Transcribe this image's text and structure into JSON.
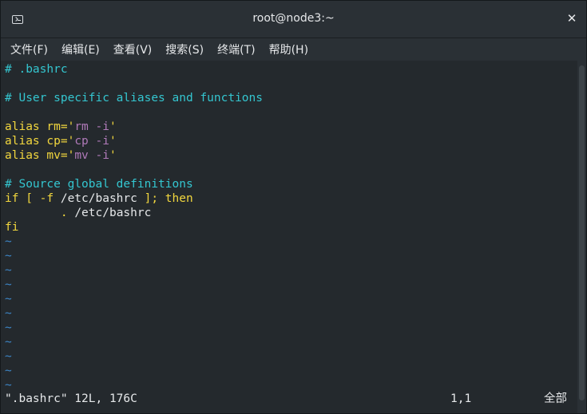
{
  "window": {
    "title": "root@node3:~"
  },
  "menu": [
    {
      "label": "文件(F)"
    },
    {
      "label": "编辑(E)"
    },
    {
      "label": "查看(V)"
    },
    {
      "label": "搜索(S)"
    },
    {
      "label": "终端(T)"
    },
    {
      "label": "帮助(H)"
    }
  ],
  "editor": {
    "lines": [
      [
        {
          "t": "# .bashrc",
          "c": "comment"
        }
      ],
      [],
      [
        {
          "t": "# User specific aliases and functions",
          "c": "comment"
        }
      ],
      [],
      [
        {
          "t": "alias ",
          "c": "keyword"
        },
        {
          "t": "rm",
          "c": "keyword"
        },
        {
          "t": "='",
          "c": "keyword"
        },
        {
          "t": "rm -i",
          "c": "string"
        },
        {
          "t": "'",
          "c": "keyword"
        }
      ],
      [
        {
          "t": "alias ",
          "c": "keyword"
        },
        {
          "t": "cp",
          "c": "keyword"
        },
        {
          "t": "='",
          "c": "keyword"
        },
        {
          "t": "cp -i",
          "c": "string"
        },
        {
          "t": "'",
          "c": "keyword"
        }
      ],
      [
        {
          "t": "alias ",
          "c": "keyword"
        },
        {
          "t": "mv",
          "c": "keyword"
        },
        {
          "t": "='",
          "c": "keyword"
        },
        {
          "t": "mv -i",
          "c": "string"
        },
        {
          "t": "'",
          "c": "keyword"
        }
      ],
      [],
      [
        {
          "t": "# Source global definitions",
          "c": "comment"
        }
      ],
      [
        {
          "t": "if [ -f ",
          "c": "keyword"
        },
        {
          "t": "/etc/bashrc",
          "c": "plain"
        },
        {
          "t": " ]; then",
          "c": "keyword"
        }
      ],
      [
        {
          "t": "        . ",
          "c": "keyword"
        },
        {
          "t": "/etc/bashrc",
          "c": "plain"
        }
      ],
      [
        {
          "t": "fi",
          "c": "keyword"
        }
      ],
      [
        {
          "t": "~",
          "c": "tilde"
        }
      ],
      [
        {
          "t": "~",
          "c": "tilde"
        }
      ],
      [
        {
          "t": "~",
          "c": "tilde"
        }
      ],
      [
        {
          "t": "~",
          "c": "tilde"
        }
      ],
      [
        {
          "t": "~",
          "c": "tilde"
        }
      ],
      [
        {
          "t": "~",
          "c": "tilde"
        }
      ],
      [
        {
          "t": "~",
          "c": "tilde"
        }
      ],
      [
        {
          "t": "~",
          "c": "tilde"
        }
      ],
      [
        {
          "t": "~",
          "c": "tilde"
        }
      ],
      [
        {
          "t": "~",
          "c": "tilde"
        }
      ],
      [
        {
          "t": "~",
          "c": "tilde"
        }
      ]
    ]
  },
  "status": {
    "file": "\".bashrc\" 12L, 176C",
    "position": "1,1",
    "scope": "全部"
  },
  "colors": {
    "comment": "#34c6d0",
    "keyword": "#f2d73e",
    "string": "#b07ab9",
    "tilde": "#3d86c7",
    "background": "#24292d"
  }
}
